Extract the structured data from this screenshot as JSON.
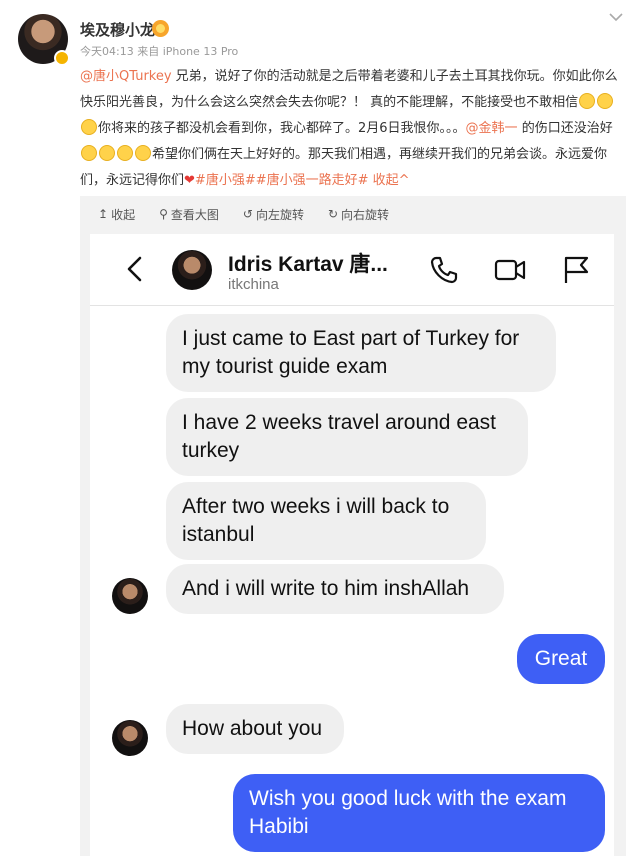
{
  "post": {
    "username": "埃及穆小龙",
    "meta": "今天04:13  来自 iPhone 13 Pro",
    "segments": {
      "mention1": "@唐小QTurkey",
      "text1": " 兄弟，说好了你的活动就是之后带着老婆和儿子去土耳其找你玩。你如此你么快乐阳光善良，为什么会这么突然会失去你呢？！ 真的不能理解，不能接受也不敢相信",
      "text2": "你将来的孩子都没机会看到你，我心都碎了。2月6日我恨你。。。",
      "mention2": "@金韩一",
      "text3": " 的伤口还没治好",
      "text4": "希望你们俩在天上好好的。那天我们相遇，再继续开我们的兄弟会谈。永远爱你们，永远记得你们",
      "tags": "#唐小强##唐小强一路走好#",
      "collapse": " 收起^"
    }
  },
  "toolbar": {
    "collapse": "收起",
    "view_large": "查看大图",
    "rotate_left": "向左旋转",
    "rotate_right": "向右旋转"
  },
  "chat": {
    "name": "Idris Kartav 唐...",
    "handle": "itkchina",
    "messages": [
      {
        "dir": "in",
        "text": "I just came to East part of Turkey for my tourist guide exam"
      },
      {
        "dir": "in",
        "text": "I have 2 weeks travel around east turkey"
      },
      {
        "dir": "in",
        "text": "After two weeks i will back to istanbul"
      },
      {
        "dir": "in",
        "text": "And i will write to him inshAllah"
      },
      {
        "dir": "out",
        "text": "Great"
      },
      {
        "dir": "in",
        "text": "How about you"
      },
      {
        "dir": "out",
        "text": "Wish you good luck with the exam Habibi"
      }
    ]
  },
  "colors": {
    "accent": "#eb7350",
    "outgoing_bubble": "#3e5ff5",
    "incoming_bubble": "#efefef"
  },
  "icons": [
    "back-icon",
    "phone-icon",
    "video-icon",
    "flag-icon",
    "chevron-down-icon"
  ]
}
